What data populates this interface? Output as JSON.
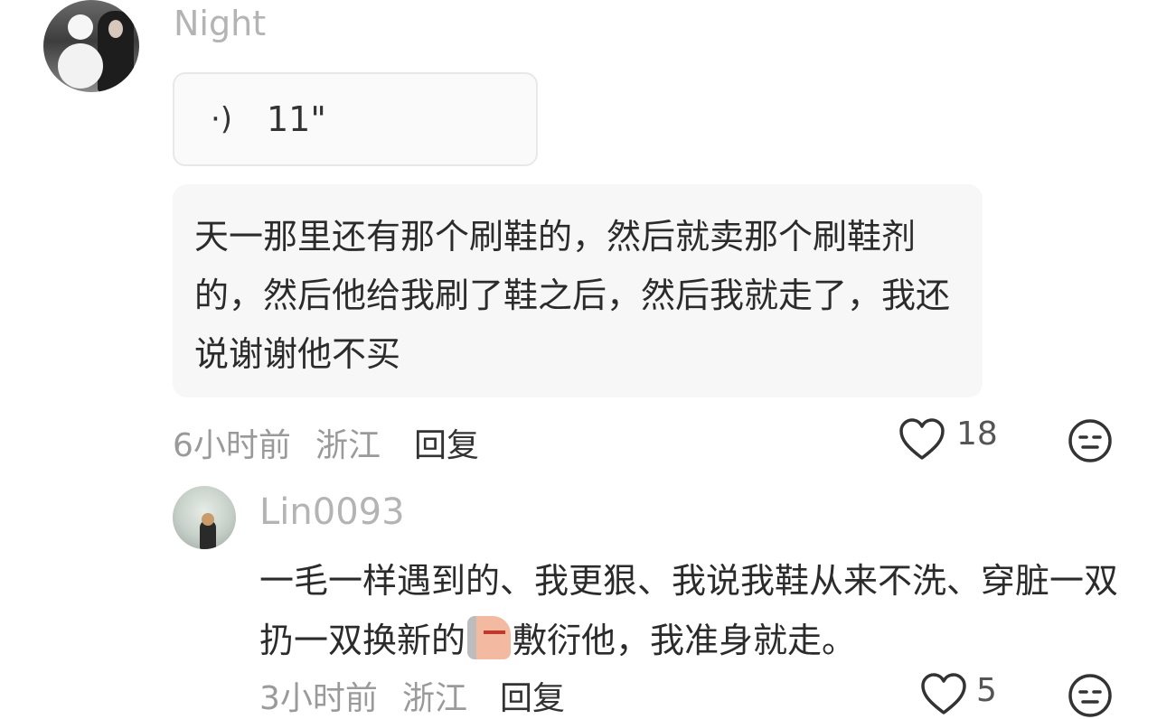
{
  "comment": {
    "username": "Night",
    "voice": {
      "icon": "voice-wave-icon",
      "duration": "11\""
    },
    "text": "天一那里还有那个刷鞋的，然后就卖那个刷鞋剂的，然后他给我刷了鞋之后，然后我就走了，我还说谢谢他不买",
    "time": "6小时前",
    "location": "浙江",
    "reply_label": "回复",
    "likes": "18",
    "like_icon": "heart-icon",
    "reaction_icon": "meh-face-icon"
  },
  "reply": {
    "username": "Lin0093",
    "text_before": "一毛一样遇到的、我更狠、我说我鞋从来不洗、穿脏一双扔一双换新的",
    "sticker_icon": "peeking-sticker-icon",
    "text_after": "敷衍他，我准身就走。",
    "time": "3小时前",
    "location": "浙江",
    "reply_label": "回复",
    "likes": "5"
  },
  "colors": {
    "muted": "#9a9a9a",
    "bubble_bg": "#f7f7f7",
    "text": "#2b2b2b"
  }
}
